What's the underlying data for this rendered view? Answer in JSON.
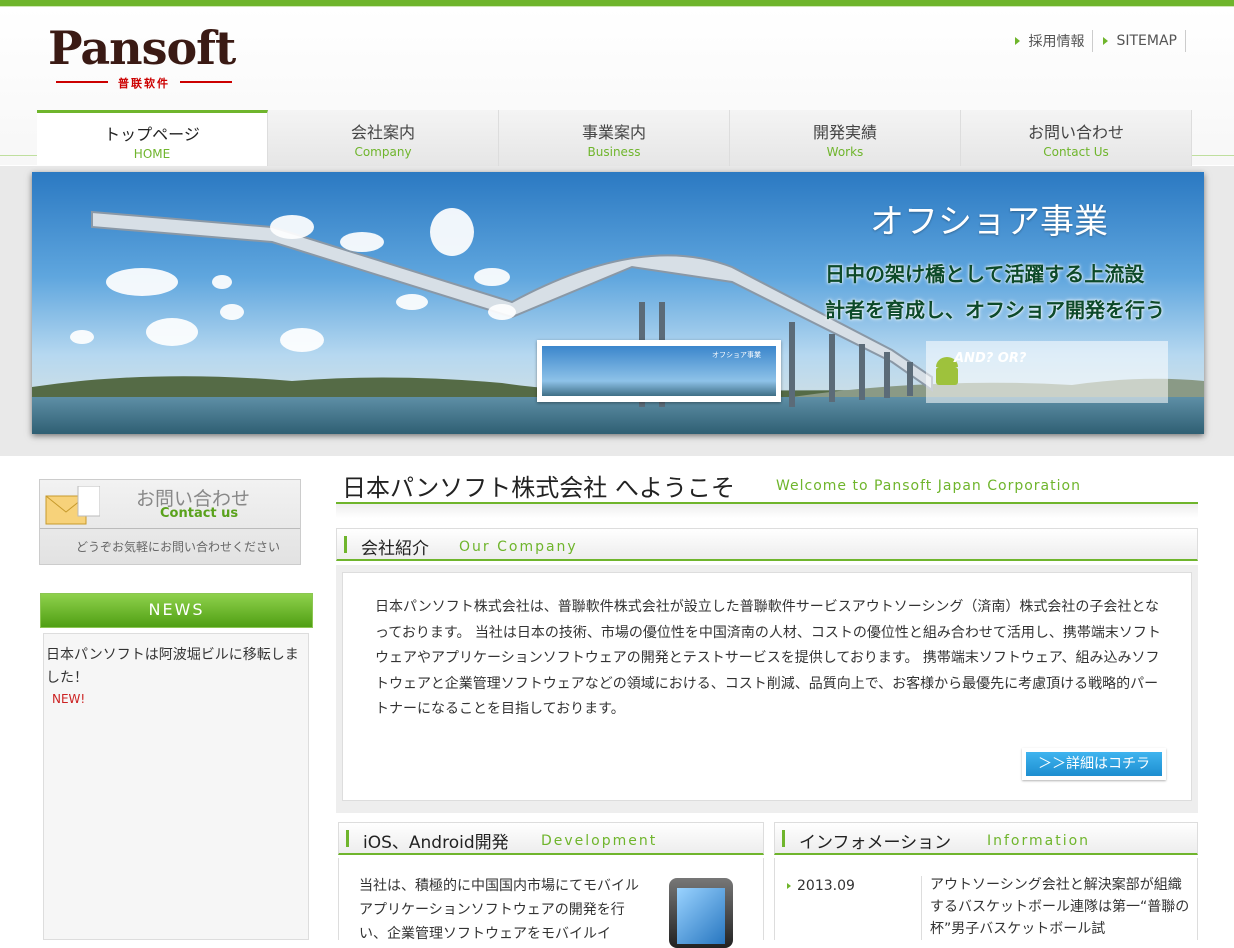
{
  "logo": {
    "name": "Pansoft",
    "sub": "普联软件"
  },
  "top_links": [
    {
      "label": "採用情報"
    },
    {
      "label": "SITEMAP"
    }
  ],
  "nav": [
    {
      "jp": "トップページ",
      "en": "HOME",
      "active": true
    },
    {
      "jp": "会社案内",
      "en": "Company"
    },
    {
      "jp": "事業案内",
      "en": "Business"
    },
    {
      "jp": "開発実績",
      "en": "Works"
    },
    {
      "jp": "お問い合わせ",
      "en": "Contact Us"
    }
  ],
  "hero": {
    "title": "オフショア事業",
    "line1": "日中の架け橋として活躍する上流設",
    "line2": "計者を育成し、オフショア開発を行う",
    "thumb1_caption": "オフショア事業",
    "thumb2_caption": "AND? OR?"
  },
  "contact": {
    "jp": "お問い合わせ",
    "en": "Contact us",
    "sub": "どうぞお気軽にお問い合わせください"
  },
  "news": {
    "heading": "NEWS",
    "item": "日本パンソフトは阿波堀ビルに移転しました！",
    "badge": "NEW!"
  },
  "main": {
    "title_jp": "日本パンソフト株式会社 へようこそ",
    "title_en": "Welcome to Pansoft Japan Corporation"
  },
  "about": {
    "heading_jp": "会社紹介",
    "heading_en": "Our Company",
    "text": "日本パンソフト株式会社は、普聯軟件株式会社が設立した普聯軟件サービスアウトソーシング（済南）株式会社の子会社となっております。 当社は日本の技術、市場の優位性を中国済南の人材、コストの優位性と組み合わせて活用し、携帯端末ソフトウェアやアプリケーションソフトウェアの開発とテストサービスを提供しております。 携帯端末ソフトウェア、組み込みソフトウェアと企業管理ソフトウェアなどの領域における、コスト削減、品質向上で、お客様から最優先に考慮頂ける戦略的パートナーになることを目指しております。",
    "more": "＞＞詳細はコチラ"
  },
  "dev": {
    "heading_jp": "iOS、Android開発",
    "heading_en": "Development",
    "text": "当社は、積極的に中国国内市場にてモバイルアプリケーションソフトウェアの開発を行い、企業管理ソフトウェアをモバイルイ"
  },
  "info": {
    "heading_jp": "インフォメーション",
    "heading_en": "Information",
    "date": "2013.09",
    "text": "アウトソーシング会社と解決案部が組織するバスケットボール連隊は第一“普聯の杯”男子バスケットボール試"
  },
  "colors": {
    "accent": "#6fb52c",
    "button": "#1d8ed0"
  }
}
